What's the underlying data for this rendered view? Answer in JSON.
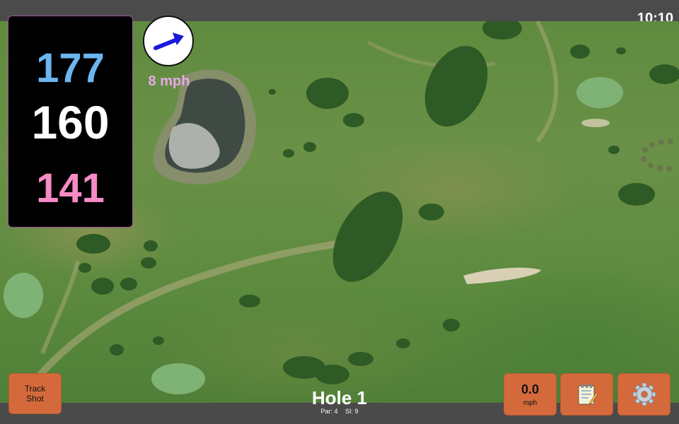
{
  "status": {
    "time": "10:10"
  },
  "distances": {
    "back": "177",
    "middle": "160",
    "front": "141"
  },
  "wind": {
    "speed": "8 mph",
    "direction_icon": "wind-arrow-icon",
    "arrow_color": "#1a1adb"
  },
  "hole": {
    "title": "Hole 1",
    "par": "Par: 4",
    "si": "SI: 9"
  },
  "buttons": {
    "track_shot_line1": "Track",
    "track_shot_line2": "Shot",
    "speed_value": "0.0",
    "speed_unit": "mph",
    "notes_icon": "notepad-icon",
    "settings_icon": "gear-icon"
  },
  "colors": {
    "back_distance": "#6cb6f0",
    "middle_distance": "#ffffff",
    "front_distance": "#f58ac4",
    "button_bg": "#d46a3b",
    "wind_text": "#e9a8ea"
  }
}
